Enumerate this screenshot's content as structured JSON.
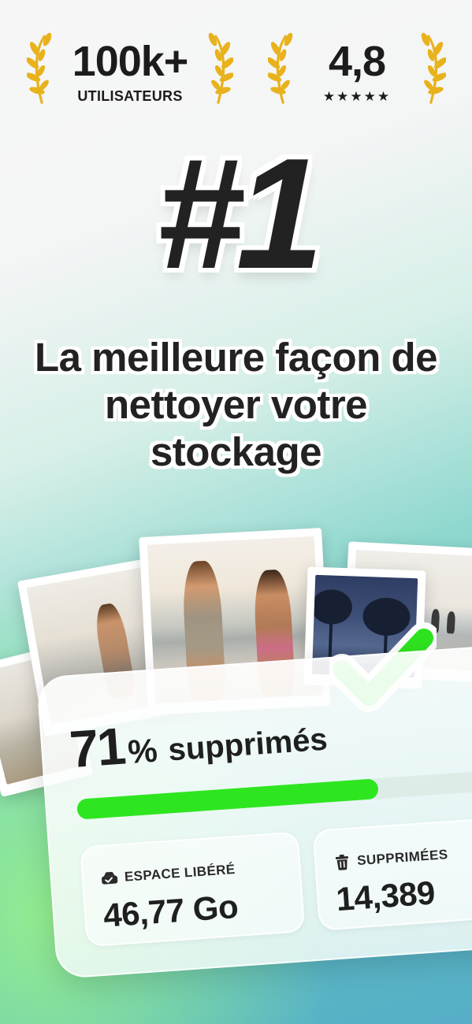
{
  "badges": {
    "users": {
      "value": "100k+",
      "label": "UTILISATEURS"
    },
    "rating": {
      "value": "4,8",
      "stars": "★★★★★"
    }
  },
  "hero": {
    "rank": "#1",
    "headline": "La meilleure façon de nettoyer votre stockage"
  },
  "card": {
    "percent_value": "71",
    "percent_sign": "%",
    "percent_label": "supprimés",
    "progress": 0.71,
    "stats": {
      "space": {
        "icon": "drive-icon",
        "label": "ESPACE LIBÉRÉ",
        "value": "46,77 Go"
      },
      "deleted": {
        "icon": "trash-icon",
        "label": "SUPPRIMÉES",
        "value": "14,389"
      }
    }
  },
  "colors": {
    "progress_fill": "#2ee620",
    "check_green": "#2ee620",
    "laurel_gold": "#e8b21c",
    "text_dark": "#1f1f1f"
  }
}
